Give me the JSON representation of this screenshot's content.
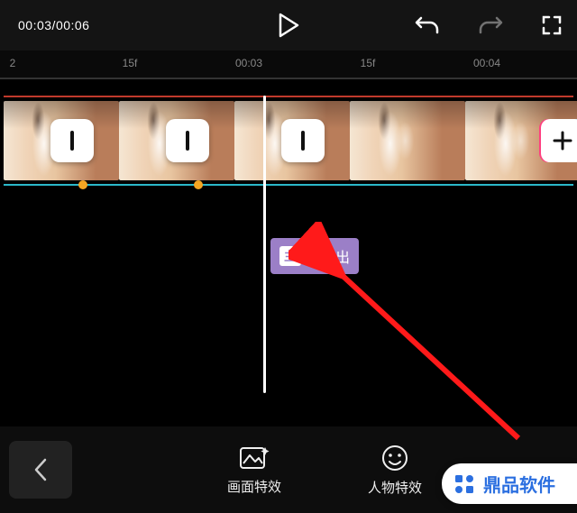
{
  "time": {
    "current": "00:03",
    "total": "00:06"
  },
  "ruler": {
    "ticks": [
      {
        "label": "2",
        "pos": 14
      },
      {
        "label": "15f",
        "pos": 144
      },
      {
        "label": "00:03",
        "pos": 276
      },
      {
        "label": "15f",
        "pos": 408
      },
      {
        "label": "00:04",
        "pos": 540
      }
    ]
  },
  "effect": {
    "tag": "主",
    "label": "灵魂出"
  },
  "bottom": {
    "image_fx": "画面特效",
    "face_fx": "人物特效"
  },
  "brand": "鼎品软件",
  "icons": {
    "play": "play-icon",
    "undo": "undo-icon",
    "redo": "redo-icon",
    "fullscreen": "fullscreen-icon",
    "back": "chevron-left-icon",
    "image_fx": "image-sparkle-icon",
    "face_fx": "smiley-icon",
    "brand": "brand-logo-icon",
    "add": "plus-icon"
  },
  "colors": {
    "accent": "#9b7fc7",
    "ruler_red": "#c0392b",
    "ruler_cyan": "#2bb8c9",
    "arrow": "#ff1a1a"
  }
}
